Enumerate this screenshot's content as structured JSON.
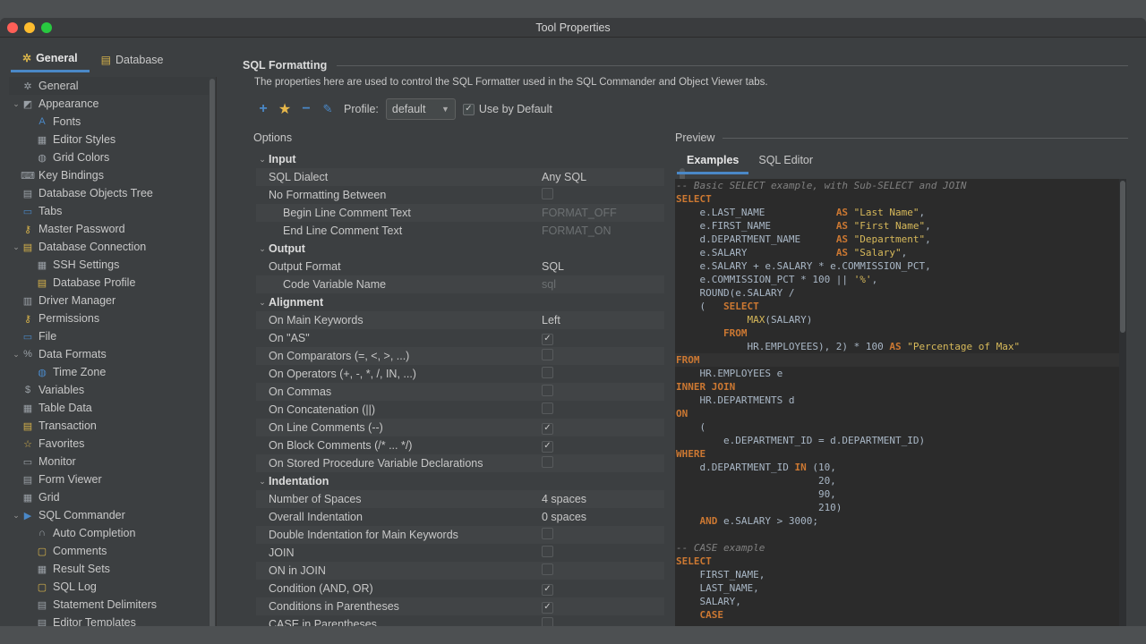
{
  "window": {
    "title": "Tool Properties"
  },
  "left_tabs": [
    {
      "label": "General",
      "icon": "wrench-icon",
      "active": true
    },
    {
      "label": "Database",
      "icon": "database-icon",
      "active": false
    }
  ],
  "tree": [
    {
      "label": "General",
      "level": 0,
      "icon": "wrench-icon",
      "arrow": "",
      "selected": true
    },
    {
      "label": "Appearance",
      "level": 0,
      "icon": "appearance-icon",
      "arrow": "v"
    },
    {
      "label": "Fonts",
      "level": 1,
      "icon": "fonts-icon"
    },
    {
      "label": "Editor Styles",
      "level": 1,
      "icon": "styles-icon"
    },
    {
      "label": "Grid Colors",
      "level": 1,
      "icon": "palette-icon"
    },
    {
      "label": "Key Bindings",
      "level": 0,
      "icon": "keyboard-icon"
    },
    {
      "label": "Database Objects Tree",
      "level": 0,
      "icon": "tree-icon"
    },
    {
      "label": "Tabs",
      "level": 0,
      "icon": "tabs-icon"
    },
    {
      "label": "Master Password",
      "level": 0,
      "icon": "key-icon"
    },
    {
      "label": "Database Connection",
      "level": 0,
      "icon": "database-icon",
      "arrow": "v"
    },
    {
      "label": "SSH Settings",
      "level": 1,
      "icon": "ssh-icon"
    },
    {
      "label": "Database Profile",
      "level": 1,
      "icon": "profile-icon"
    },
    {
      "label": "Driver Manager",
      "level": 0,
      "icon": "driver-icon"
    },
    {
      "label": "Permissions",
      "level": 0,
      "icon": "key-icon"
    },
    {
      "label": "File",
      "level": 0,
      "icon": "file-icon"
    },
    {
      "label": "Data Formats",
      "level": 0,
      "icon": "percent-icon",
      "arrow": "v"
    },
    {
      "label": "Time Zone",
      "level": 1,
      "icon": "globe-icon"
    },
    {
      "label": "Variables",
      "level": 0,
      "icon": "dollar-icon"
    },
    {
      "label": "Table Data",
      "level": 0,
      "icon": "table-icon"
    },
    {
      "label": "Transaction",
      "level": 0,
      "icon": "transaction-icon"
    },
    {
      "label": "Favorites",
      "level": 0,
      "icon": "star-icon"
    },
    {
      "label": "Monitor",
      "level": 0,
      "icon": "monitor-icon"
    },
    {
      "label": "Form Viewer",
      "level": 0,
      "icon": "form-icon"
    },
    {
      "label": "Grid",
      "level": 0,
      "icon": "grid-icon"
    },
    {
      "label": "SQL Commander",
      "level": 0,
      "icon": "play-icon",
      "arrow": "v"
    },
    {
      "label": "Auto Completion",
      "level": 1,
      "icon": "completion-icon"
    },
    {
      "label": "Comments",
      "level": 1,
      "icon": "comment-icon"
    },
    {
      "label": "Result Sets",
      "level": 1,
      "icon": "table-icon"
    },
    {
      "label": "SQL Log",
      "level": 1,
      "icon": "log-icon"
    },
    {
      "label": "Statement Delimiters",
      "level": 1,
      "icon": "delimiter-icon"
    },
    {
      "label": "Editor Templates",
      "level": 1,
      "icon": "template-icon"
    }
  ],
  "section": {
    "title": "SQL Formatting",
    "description": "The properties here are used to control the SQL Formatter used in the SQL Commander and Object Viewer tabs."
  },
  "toolbar": {
    "profile_label": "Profile:",
    "profile_value": "default",
    "use_default_label": "Use by Default",
    "use_default_checked": true
  },
  "options": {
    "label": "Options",
    "rows": [
      {
        "type": "group",
        "name": "Input"
      },
      {
        "name": "SQL Dialect",
        "value": "Any SQL"
      },
      {
        "name": "No Formatting Between",
        "check": false
      },
      {
        "name": "Begin Line Comment Text",
        "value": "FORMAT_OFF",
        "sub": true,
        "dim": true
      },
      {
        "name": "End Line Comment Text",
        "value": "FORMAT_ON",
        "sub": true,
        "dim": true
      },
      {
        "type": "group",
        "name": "Output"
      },
      {
        "name": "Output Format",
        "value": "SQL"
      },
      {
        "name": "Code Variable Name",
        "value": "sql",
        "sub": true,
        "dim": true
      },
      {
        "type": "group",
        "name": "Alignment"
      },
      {
        "name": "On Main Keywords",
        "value": "Left"
      },
      {
        "name": "On \"AS\"",
        "check": true
      },
      {
        "name": "On Comparators (=, <, >, ...)",
        "check": false
      },
      {
        "name": "On Operators (+, -, *, /, IN, ...)",
        "check": false
      },
      {
        "name": "On Commas",
        "check": false
      },
      {
        "name": "On Concatenation (||)",
        "check": false
      },
      {
        "name": "On Line Comments (--)",
        "check": true
      },
      {
        "name": "On Block Comments (/* ... */)",
        "check": true
      },
      {
        "name": "On Stored Procedure Variable Declarations",
        "check": false
      },
      {
        "type": "group",
        "name": "Indentation"
      },
      {
        "name": "Number of Spaces",
        "value": "4 spaces"
      },
      {
        "name": "Overall Indentation",
        "value": "0 spaces"
      },
      {
        "name": "Double Indentation for Main Keywords",
        "check": false
      },
      {
        "name": "JOIN",
        "check": false
      },
      {
        "name": "ON in JOIN",
        "check": false
      },
      {
        "name": "Condition (AND, OR)",
        "check": true
      },
      {
        "name": "Conditions in Parentheses",
        "check": true
      },
      {
        "name": "CASE in Parentheses",
        "check": false
      }
    ]
  },
  "preview": {
    "label": "Preview",
    "tabs": [
      {
        "label": "Examples",
        "active": true
      },
      {
        "label": "SQL Editor",
        "active": false
      }
    ],
    "code": [
      [
        [
          "cm",
          "-- Basic SELECT example, with Sub-SELECT and JOIN"
        ]
      ],
      [
        [
          "kw",
          "SELECT"
        ]
      ],
      [
        [
          "",
          "    e.LAST_NAME            "
        ],
        [
          "kw",
          "AS"
        ],
        [
          "str",
          " \"Last Name\""
        ],
        [
          "",
          ","
        ]
      ],
      [
        [
          "",
          "    e.FIRST_NAME           "
        ],
        [
          "kw",
          "AS"
        ],
        [
          "str",
          " \"First Name\""
        ],
        [
          "",
          ","
        ]
      ],
      [
        [
          "",
          "    d.DEPARTMENT_NAME      "
        ],
        [
          "kw",
          "AS"
        ],
        [
          "str",
          " \"Department\""
        ],
        [
          "",
          ","
        ]
      ],
      [
        [
          "",
          "    e.SALARY               "
        ],
        [
          "kw",
          "AS"
        ],
        [
          "str",
          " \"Salary\""
        ],
        [
          "",
          ","
        ]
      ],
      [
        [
          "",
          "    e.SALARY + e.SALARY * e.COMMISSION_PCT,"
        ]
      ],
      [
        [
          "",
          "    e.COMMISSION_PCT * 100 || "
        ],
        [
          "str",
          "'%'"
        ],
        [
          "",
          ","
        ]
      ],
      [
        [
          "",
          "    ROUND(e.SALARY /"
        ]
      ],
      [
        [
          "",
          "    (   "
        ],
        [
          "kw",
          "SELECT"
        ]
      ],
      [
        [
          "",
          "            "
        ],
        [
          "str",
          "MAX"
        ],
        [
          "",
          "(SALARY)"
        ]
      ],
      [
        [
          "",
          "        "
        ],
        [
          "kw",
          "FROM"
        ]
      ],
      [
        [
          "",
          "            HR.EMPLOYEES), 2) * 100 "
        ],
        [
          "kw",
          "AS"
        ],
        [
          "str",
          " \"Percentage of Max\""
        ]
      ],
      [
        [
          "kw",
          "FROM"
        ]
      ],
      [
        [
          "",
          "    HR.EMPLOYEES e"
        ]
      ],
      [
        [
          "kw",
          "INNER JOIN"
        ]
      ],
      [
        [
          "",
          "    HR.DEPARTMENTS d"
        ]
      ],
      [
        [
          "kw",
          "ON"
        ]
      ],
      [
        [
          "",
          "    ("
        ]
      ],
      [
        [
          "",
          "        e.DEPARTMENT_ID = d.DEPARTMENT_ID)"
        ]
      ],
      [
        [
          "kw",
          "WHERE"
        ]
      ],
      [
        [
          "",
          "    d.DEPARTMENT_ID "
        ],
        [
          "kw",
          "IN"
        ],
        [
          "",
          " (10,"
        ]
      ],
      [
        [
          "",
          "                        20,"
        ]
      ],
      [
        [
          "",
          "                        90,"
        ]
      ],
      [
        [
          "",
          "                        210)"
        ]
      ],
      [
        [
          "",
          "    "
        ],
        [
          "kw",
          "AND"
        ],
        [
          "",
          " e.SALARY > 3000;"
        ]
      ],
      [
        [
          "",
          ""
        ]
      ],
      [
        [
          "cm",
          "-- CASE example"
        ]
      ],
      [
        [
          "kw",
          "SELECT"
        ]
      ],
      [
        [
          "",
          "    FIRST_NAME,"
        ]
      ],
      [
        [
          "",
          "    LAST_NAME,"
        ]
      ],
      [
        [
          "",
          "    SALARY,"
        ]
      ],
      [
        [
          "",
          "    "
        ],
        [
          "kw",
          "CASE"
        ]
      ]
    ]
  }
}
